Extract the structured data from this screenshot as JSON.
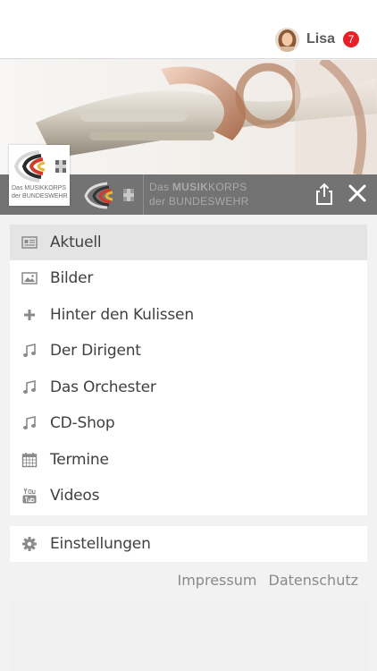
{
  "user": {
    "name": "Lisa",
    "notifications": "7"
  },
  "brand": {
    "line1_prefix": "Das ",
    "line1_strong": "MUSIK",
    "line1_rest": "KORPS",
    "line2": "der BUNDESWEHR"
  },
  "logo_card": {
    "line1": "Das MUSIKKORPS",
    "line2": "der BUNDESWEHR"
  },
  "menu": {
    "items": [
      {
        "label": "Aktuell",
        "icon": "newspaper-icon",
        "active": true
      },
      {
        "label": "Bilder",
        "icon": "image-icon"
      },
      {
        "label": "Hinter den Kulissen",
        "icon": "plus-icon"
      },
      {
        "label": "Der Dirigent",
        "icon": "music-note-icon"
      },
      {
        "label": "Das Orchester",
        "icon": "music-note-icon"
      },
      {
        "label": "CD-Shop",
        "icon": "music-note-icon"
      },
      {
        "label": "Termine",
        "icon": "calendar-icon"
      },
      {
        "label": "Videos",
        "icon": "youtube-icon"
      }
    ]
  },
  "settings": {
    "label": "Einstellungen",
    "icon": "gear-icon"
  },
  "footer": {
    "impressum": "Impressum",
    "datenschutz": "Datenschutz"
  },
  "colors": {
    "badge": "#e52028",
    "logobar": "#737373",
    "active_item": "#e4e4e4"
  }
}
